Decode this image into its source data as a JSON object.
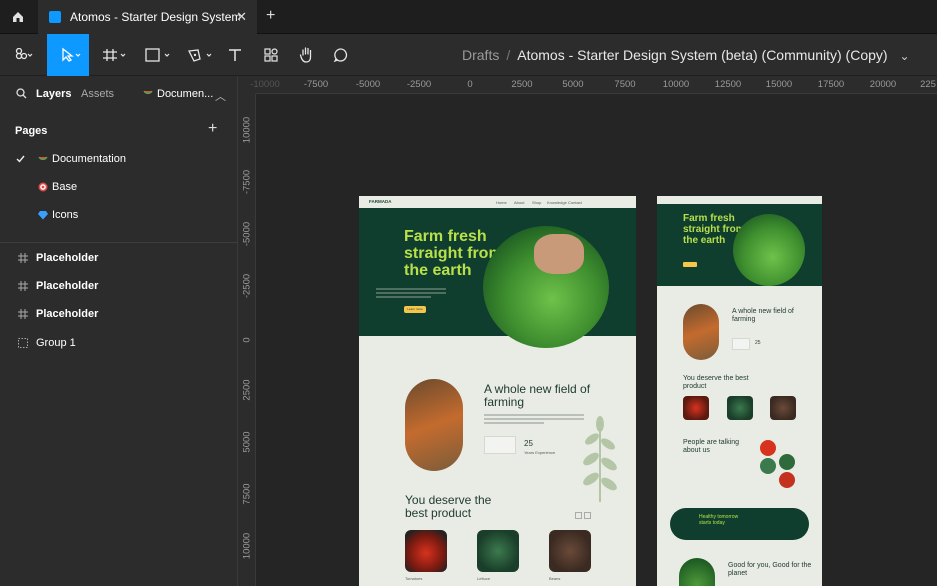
{
  "tabbar": {
    "tab_title": "Atomos - Starter Design System (b",
    "new_tab": "+",
    "close": "✕"
  },
  "toolbar": {
    "breadcrumb_root": "Drafts",
    "breadcrumb_sep": "/",
    "file_name": "Atomos - Starter Design System (beta) (Community) (Copy)",
    "chevron": "⌄",
    "tools": [
      "main-menu",
      "move",
      "frame",
      "shape",
      "pen",
      "text",
      "resources",
      "hand",
      "comment"
    ]
  },
  "panel": {
    "tab_layers": "Layers",
    "tab_assets": "Assets",
    "current_page": "Documen...",
    "pages_heading": "Pages",
    "add": "+",
    "pages": [
      {
        "label": "Documentation",
        "selected": true,
        "icon": "watermelon-icon"
      },
      {
        "label": "Base",
        "selected": false,
        "icon": "target-icon"
      },
      {
        "label": "Icons",
        "selected": false,
        "icon": "gem-icon"
      }
    ],
    "layers": [
      {
        "label": "Placeholder",
        "icon": "frame-icon"
      },
      {
        "label": "Placeholder",
        "icon": "frame-icon"
      },
      {
        "label": "Placeholder",
        "icon": "frame-icon"
      },
      {
        "label": "Group 1",
        "icon": "group-icon"
      }
    ]
  },
  "rulers": {
    "top": [
      "-10000",
      "-7500",
      "-5000",
      "-2500",
      "0",
      "2500",
      "5000",
      "7500",
      "10000",
      "12500",
      "15000",
      "17500",
      "20000",
      "225"
    ],
    "left": [
      "10000",
      "-7500",
      "-5000",
      "-2500",
      "0",
      "2500",
      "5000",
      "7500",
      "10000"
    ]
  },
  "design_desktop": {
    "logo": "FARMADA",
    "nav": [
      "Home",
      "About",
      "Shop",
      "Knowledge",
      "Contact"
    ],
    "hero_title": "Farm fresh straight from the earth",
    "hero_button": "Learn more",
    "section2_title": "A whole new field of farming",
    "stat_value": "25",
    "stat_label": "Years Experience",
    "section3_title": "You deserve the best product",
    "products": [
      "Tomatoes",
      "Lettuce",
      "Beans"
    ]
  },
  "design_mobile": {
    "hero_title": "Farm fresh straight from the earth",
    "section2_title": "A whole new field of farming",
    "stat_value": "25",
    "section3_title": "You deserve the best product",
    "section4_title": "People are talking about us",
    "banner_title": "Healthy tomorrow starts today",
    "section5_title": "Good for you, Good for the planet"
  },
  "colors": {
    "accent": "#0d99ff",
    "brand_dark": "#0f3d2e",
    "brand_lime": "#b7e04a",
    "canvas": "#252525"
  }
}
